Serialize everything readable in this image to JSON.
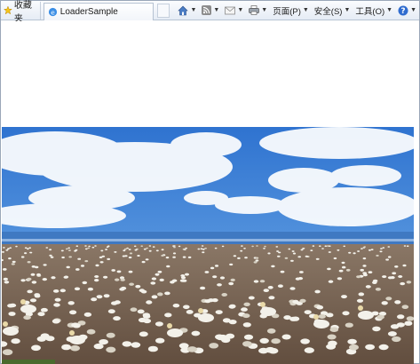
{
  "toolbar": {
    "favorites_label": "收藏夹",
    "tab_title": "LoaderSample",
    "page_menu": "页面(P)",
    "safety_menu": "安全(S)",
    "tools_menu": "工具(O)"
  },
  "icons": {
    "favorites": "star-icon",
    "tab": "ie-page-icon",
    "home": "home-icon",
    "feeds": "rss-feed-icon",
    "mail": "mail-icon",
    "print": "printer-icon",
    "help": "help-icon"
  },
  "colors": {
    "sky": "#3d7fd6",
    "ground": "#6b5646",
    "bird": "#f3f1ea"
  }
}
